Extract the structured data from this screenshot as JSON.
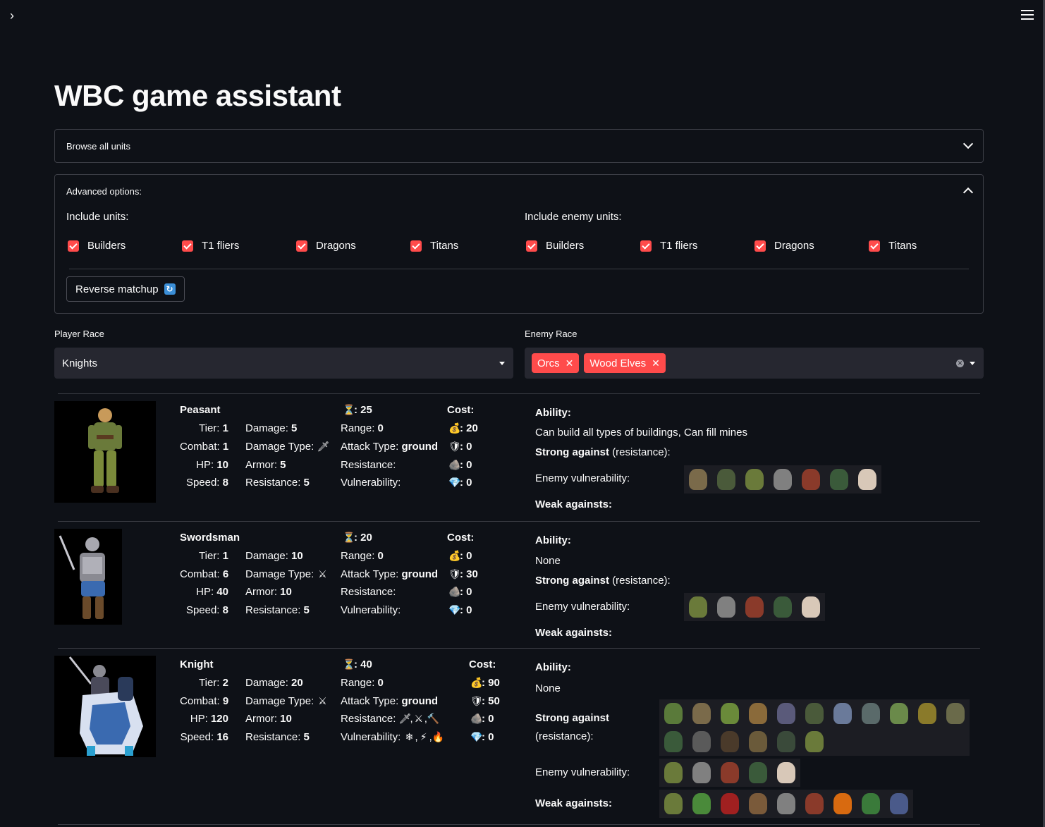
{
  "app": {
    "title": "WBC game assistant",
    "sidebar_toggle": "›"
  },
  "browse": {
    "label": "Browse all units"
  },
  "advanced": {
    "label": "Advanced options:",
    "include_units_label": "Include units:",
    "include_enemy_label": "Include enemy units:",
    "include_units": [
      "Builders",
      "T1 fliers",
      "Dragons",
      "Titans"
    ],
    "include_enemy_units": [
      "Builders",
      "T1 fliers",
      "Dragons",
      "Titans"
    ],
    "reverse_button": "Reverse matchup",
    "reverse_icon": "🔃"
  },
  "player_race": {
    "label": "Player Race",
    "value": "Knights"
  },
  "enemy_race": {
    "label": "Enemy Race",
    "tags": [
      "Orcs",
      "Wood Elves"
    ]
  },
  "labels": {
    "tier": "Tier:",
    "combat": "Combat:",
    "hp": "HP:",
    "speed": "Speed:",
    "damage": "Damage:",
    "damage_type": "Damage Type:",
    "armor": "Armor:",
    "resistance": "Resistance:",
    "range": "Range:",
    "attack_type": "Attack Type:",
    "vulnerability": "Vulnerability:",
    "cost": "Cost:",
    "ability": "Ability:",
    "strong_against": "Strong against",
    "strong_paren": "(resistance):",
    "enemy_vuln": "Enemy vulnerability:",
    "weak_against": "Weak againsts:",
    "colon_sep": ": ",
    "comma": ","
  },
  "icons": {
    "time": "⏳",
    "gold": "💰",
    "wood": "🛡",
    "stone": "🪨",
    "gem": "💎"
  },
  "units": [
    {
      "name": "Peasant",
      "tier": "1",
      "combat": "1",
      "hp": "10",
      "speed": "8",
      "damage": "5",
      "damage_type_icon": "🗡",
      "armor": "5",
      "resistance": "5",
      "time": "25",
      "range": "0",
      "attack_type": "ground",
      "res_icons": [],
      "vuln_icons": [],
      "cost_gold": "20",
      "cost_wood": "0",
      "cost_stone": "0",
      "cost_gem": "0",
      "ability": "Can build all types of buildings, Can fill mines",
      "strong": [],
      "enemy_vuln": [
        "#7a6a4a",
        "#4a5a3a",
        "#6a7a3a",
        "#808080",
        "#8a3a2a",
        "#3a5a3a",
        "#d8c8b8"
      ],
      "weak": []
    },
    {
      "name": "Swordsman",
      "tier": "1",
      "combat": "6",
      "hp": "40",
      "speed": "8",
      "damage": "10",
      "damage_type_icon": "⚔",
      "armor": "10",
      "resistance": "5",
      "time": "20",
      "range": "0",
      "attack_type": "ground",
      "res_icons": [],
      "vuln_icons": [],
      "cost_gold": "0",
      "cost_wood": "30",
      "cost_stone": "0",
      "cost_gem": "0",
      "ability": "None",
      "strong": [],
      "enemy_vuln": [
        "#6a7a3a",
        "#808080",
        "#8a3a2a",
        "#3a5a3a",
        "#d8c8b8"
      ],
      "weak": []
    },
    {
      "name": "Knight",
      "tier": "2",
      "combat": "9",
      "hp": "120",
      "speed": "16",
      "damage": "20",
      "damage_type_icon": "⚔",
      "armor": "10",
      "resistance": "5",
      "time": "40",
      "range": "0",
      "attack_type": "ground",
      "res_icons": [
        "🗡",
        "⚔",
        "🔨"
      ],
      "vuln_icons": [
        "❄",
        "⚡",
        "🔥"
      ],
      "cost_gold": "90",
      "cost_wood": "50",
      "cost_stone": "0",
      "cost_gem": "0",
      "ability": "None",
      "strong": [
        "#5a7a3a",
        "#7a6a4a",
        "#6a8a3a",
        "#8a6a3a",
        "#5a5a7a",
        "#4a5a3a",
        "#6a7a9a",
        "#5a6a6a",
        "#6a8a4a",
        "#8a7a2a",
        "#6a6a4a",
        "#3a5a3a",
        "#5a5a5a",
        "#4a3a2a",
        "#6a5a3a",
        "#3a4a3a",
        "#6a7a3a"
      ],
      "enemy_vuln": [
        "#6a7a3a",
        "#808080",
        "#8a3a2a",
        "#3a5a3a",
        "#d8c8b8"
      ],
      "weak": [
        "#6a7a3a",
        "#4a8a3a",
        "#a02020",
        "#7a5a3a",
        "#808080",
        "#8a3a2a",
        "#d86a10",
        "#3a7a3a",
        "#4a5a8a"
      ]
    }
  ]
}
